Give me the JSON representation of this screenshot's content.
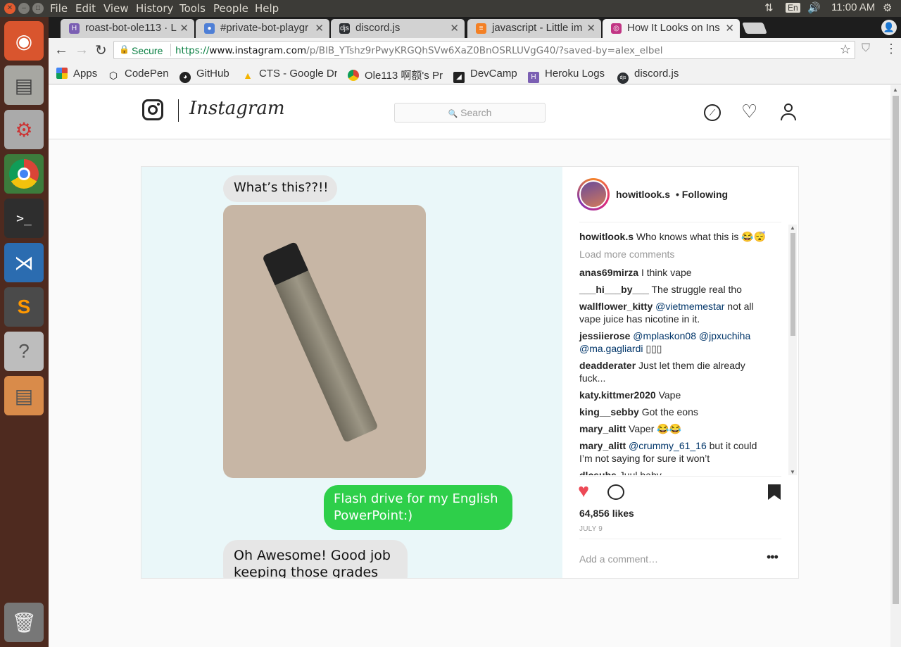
{
  "system": {
    "menus": [
      "File",
      "Edit",
      "View",
      "History",
      "Tools",
      "People",
      "Help"
    ],
    "keyboard": "En",
    "clock": "11:00 AM"
  },
  "tabs": [
    {
      "label": "roast-bot-ole113 · L",
      "icon_color": "#7b5fb3"
    },
    {
      "label": "#private-bot-playgr",
      "icon_color": "#4e7fd6"
    },
    {
      "label": "discord.js",
      "icon_color": "#2c2f33"
    },
    {
      "label": "javascript - Little im",
      "icon_color": "#f48024"
    },
    {
      "label": "How It Looks on Ins",
      "icon_color": "#c13584",
      "active": true
    }
  ],
  "address": {
    "secure_label": "Secure",
    "url_scheme": "https://",
    "url_host": "www.instagram.com",
    "url_path": "/p/BlB_YTshz9rPwyKRGQhSVw6XaZ0BnOSRLUVgG40/?saved-by=alex_elbel"
  },
  "bookmarks": [
    {
      "label": "Apps",
      "icon": "apps-grid-icon"
    },
    {
      "label": "CodePen",
      "icon": "codepen-icon"
    },
    {
      "label": "GitHub",
      "icon": "github-icon"
    },
    {
      "label": "CTS - Google Dri",
      "icon": "google-drive-icon"
    },
    {
      "label": "Ole113 啊额's Pr",
      "icon": "chrome-profile-icon"
    },
    {
      "label": "DevCamp",
      "icon": "devcamp-icon"
    },
    {
      "label": "Heroku Logs",
      "icon": "heroku-icon"
    },
    {
      "label": "discord.js",
      "icon": "discord-icon"
    }
  ],
  "instagram": {
    "wordmark": "Instagram",
    "search_placeholder": "Search"
  },
  "post": {
    "author": "howitlook.s",
    "follow_state": "• Following",
    "caption_user": "howitlook.s",
    "caption_text": "Who knows what this is 😂😴",
    "load_more": "Load more comments",
    "likes": "64,856 likes",
    "date": "JULY 9",
    "add_comment_placeholder": "Add a comment…",
    "image_texts": {
      "bubble1": "What’s this??!!",
      "bubble2": "Flash drive for my English PowerPoint:)",
      "bubble3": "Oh Awesome! Good job keeping those grades up!"
    },
    "comments": [
      {
        "user": "anas69mirza",
        "text": "I think vape"
      },
      {
        "user": "___hi___by___",
        "text": "The struggle real tho"
      },
      {
        "user": "wallflower_kitty",
        "mention": "@vietmemestar",
        "text": "not all vape juice has nicotine in it."
      },
      {
        "user": "jessiierose",
        "mention": "@mplaskon08 @jpxuchiha @ma.gagliardi",
        "text": "▯▯▯"
      },
      {
        "user": "deadderater",
        "text": "Just let them die already fuck..."
      },
      {
        "user": "katy.kittmer2020",
        "text": "Vape"
      },
      {
        "user": "king__sebby",
        "text": "Got the eons"
      },
      {
        "user": "mary_alitt",
        "text": "Vaper 😂😂"
      },
      {
        "user": "mary_alitt",
        "mention": "@crummy_61_16",
        "text": "but it could I’m not saying for sure it won’t"
      },
      {
        "user": "dlcsubs",
        "text": "Juul baby ◡ ◡ ◡"
      }
    ]
  }
}
